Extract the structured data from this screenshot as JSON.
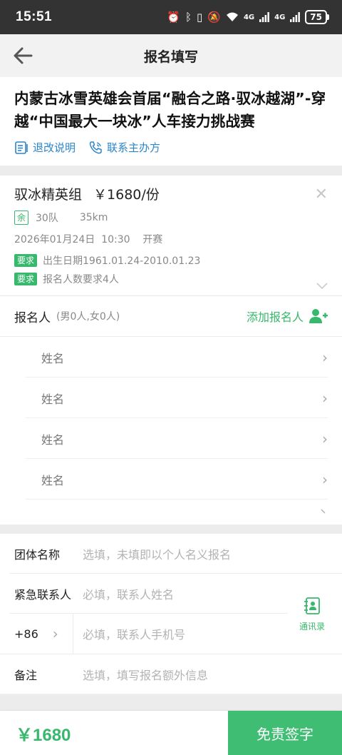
{
  "status_bar": {
    "time": "15:51",
    "battery": "75",
    "net1": "4G",
    "net2": "4G",
    "icons": [
      "alarm-icon",
      "bluetooth-icon",
      "vibrate-icon",
      "mute-icon",
      "wifi-icon",
      "signal-icon",
      "signal-icon",
      "battery-icon"
    ]
  },
  "nav": {
    "title": "报名填写",
    "back_icon": "back-arrow-icon"
  },
  "event": {
    "title": "内蒙古冰雪英雄会首届“融合之路·驭冰越湖”-穿越“中国最大一块冰”人车接力挑战赛",
    "refund_label": "退改说明",
    "contact_label": "联系主办方"
  },
  "group": {
    "name": "驭冰精英组",
    "price": "￥1680/份",
    "remain_badge": "余",
    "teams": "30队",
    "distance": "35km",
    "start": "2026年01月24日  10:30    开赛",
    "req_tag": "要求",
    "req1": "出生日期1961.01.24-2010.01.23",
    "req2": "报名人数要求4人"
  },
  "registrants": {
    "label": "报名人",
    "count": "(男0人,女0人)",
    "add_label": "添加报名人",
    "rows": [
      "姓名",
      "姓名",
      "姓名",
      "姓名"
    ]
  },
  "form": {
    "team_label": "团体名称",
    "team_placeholder": "选填，未填即以个人名义报名",
    "emergency_label": "紧急联系人",
    "emergency_placeholder": "必填，联系人姓名",
    "code": "+86",
    "phone_placeholder": "必填，联系人手机号",
    "contacts_label": "通讯录",
    "remark_label": "备注",
    "remark_placeholder": "选填，填写报名额外信息"
  },
  "footer": {
    "price": "￥1680",
    "button": "免责签字"
  },
  "colors": {
    "accent": "#37b86c",
    "link": "#2b86c9",
    "statusbar": "#333333"
  }
}
